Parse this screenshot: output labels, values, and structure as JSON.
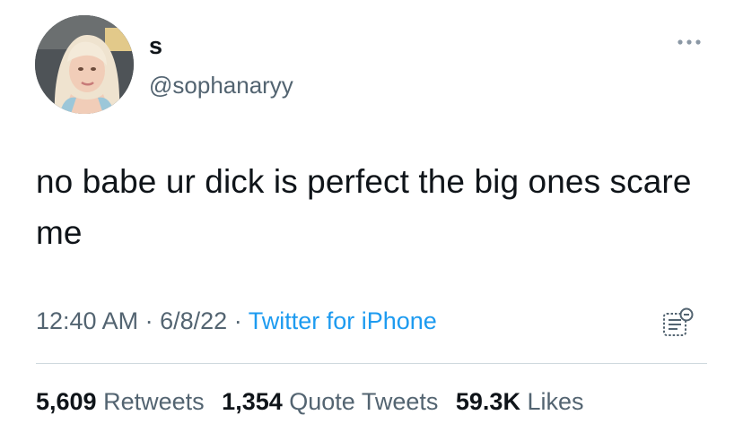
{
  "author": {
    "display_name": "s",
    "handle": "@sophanaryy"
  },
  "tweet": {
    "text": "no babe ur dick is perfect the big ones scare me",
    "time": "12:40 AM",
    "date": "6/8/22",
    "source": "Twitter for iPhone",
    "separator": "·"
  },
  "stats": {
    "retweets_count": "5,609",
    "retweets_label": "Retweets",
    "quotes_count": "1,354",
    "quotes_label": "Quote Tweets",
    "likes_count": "59.3K",
    "likes_label": "Likes"
  },
  "icons": {
    "more": "more-dots-icon",
    "analytics": "analytics-icon"
  },
  "colors": {
    "text": "#0f1419",
    "secondary": "#536471",
    "link": "#1d9bf0",
    "divider": "#cfd9de"
  }
}
